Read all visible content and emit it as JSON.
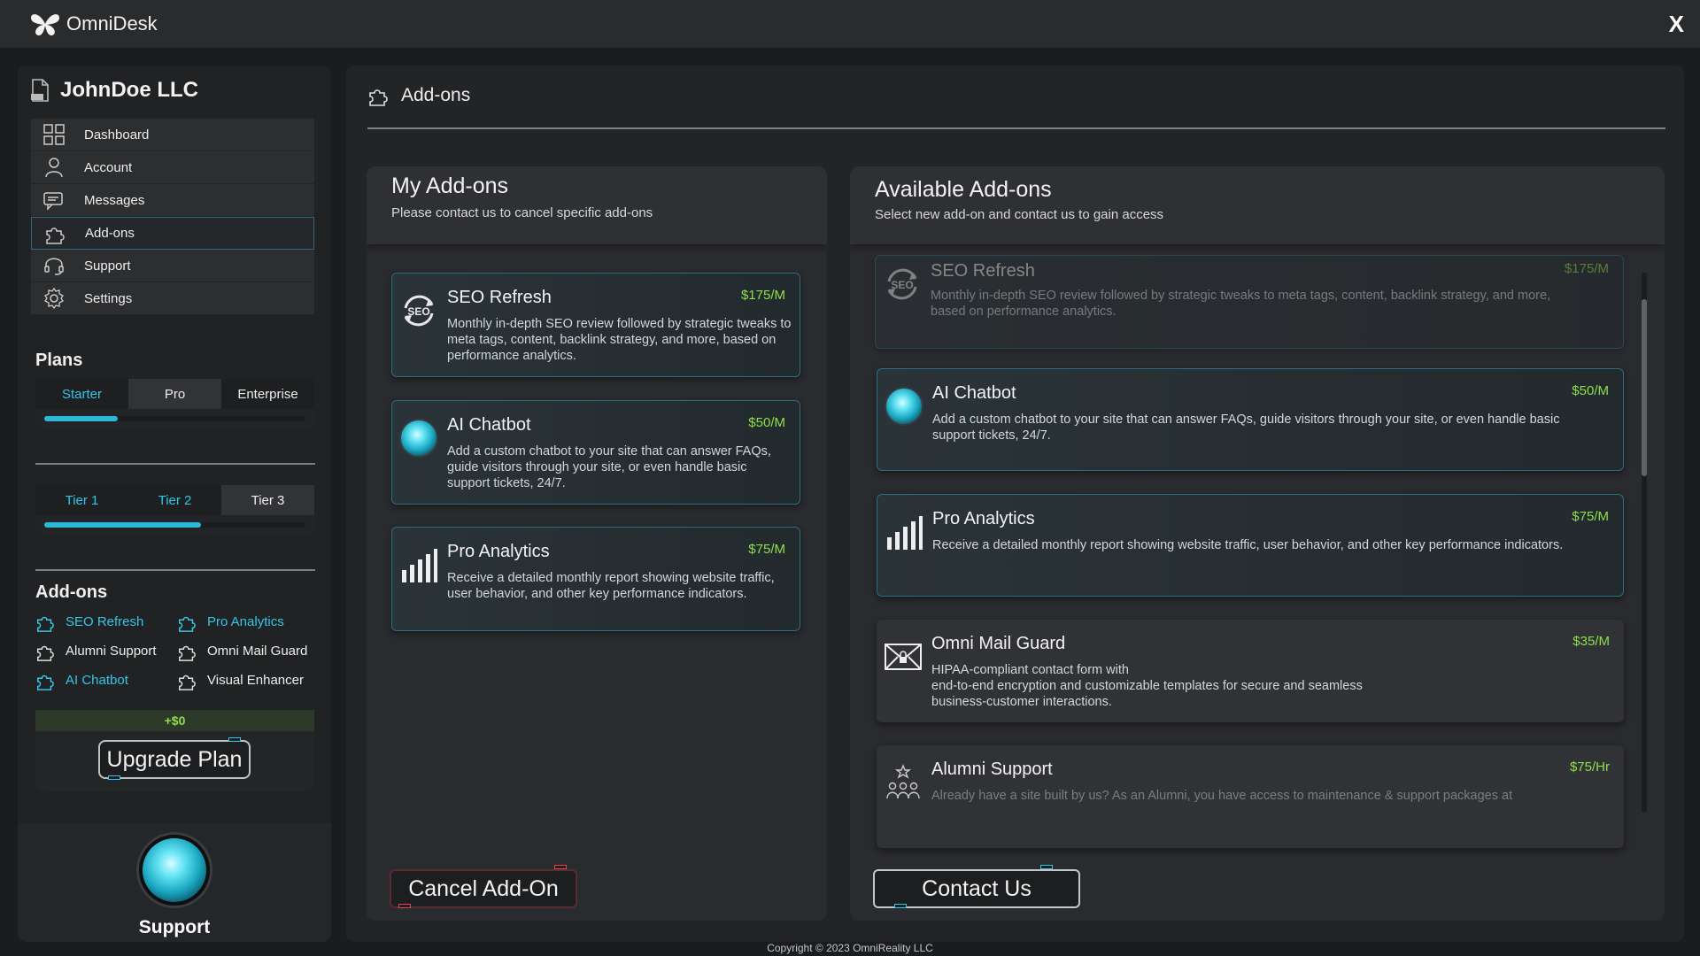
{
  "app": {
    "name": "OmniDesk",
    "close_label": "X"
  },
  "sidebar": {
    "company": "JohnDoe LLC",
    "nav": [
      {
        "label": "Dashboard",
        "icon": "grid-icon"
      },
      {
        "label": "Account",
        "icon": "user-icon"
      },
      {
        "label": "Messages",
        "icon": "chat-icon"
      },
      {
        "label": "Add-ons",
        "icon": "puzzle-icon"
      },
      {
        "label": "Support",
        "icon": "headset-icon"
      },
      {
        "label": "Settings",
        "icon": "gear-icon"
      }
    ],
    "plans_title": "Plans",
    "plan_tabs": [
      "Starter",
      "Pro",
      "Enterprise"
    ],
    "plan_progress": 0.28,
    "tier_tabs": [
      "Tier 1",
      "Tier 2",
      "Tier 3"
    ],
    "tier_progress": 0.6,
    "addons_title": "Add-ons",
    "addons": [
      {
        "label": "SEO Refresh",
        "active": true
      },
      {
        "label": "Pro Analytics",
        "active": true
      },
      {
        "label": "Alumni Support",
        "active": false
      },
      {
        "label": "Omni Mail Guard",
        "active": false
      },
      {
        "label": "AI Chatbot",
        "active": true
      },
      {
        "label": "Visual Enhancer",
        "active": false
      }
    ],
    "price_delta": "+$0",
    "upgrade_label": "Upgrade Plan",
    "support_label": "Support"
  },
  "main": {
    "header": "Add-ons",
    "my_addons": {
      "title": "My Add-ons",
      "subtitle": "Please contact us to cancel specific add-ons",
      "cards": [
        {
          "title": "SEO Refresh",
          "price": "$175/M",
          "desc": "Monthly in-depth SEO review followed by strategic tweaks to meta tags, content, backlink strategy, and more, based on performance analytics."
        },
        {
          "title": "AI Chatbot",
          "price": "$50/M",
          "desc": "Add a custom chatbot to your site that can answer FAQs, guide visitors through your site, or even handle basic support tickets, 24/7."
        },
        {
          "title": "Pro Analytics",
          "price": "$75/M",
          "desc": "Receive a detailed monthly report showing website traffic, user behavior, and other key performance indicators."
        }
      ],
      "cancel_label": "Cancel Add-On"
    },
    "available_addons": {
      "title": "Available Add-ons",
      "subtitle": "Select new add-on and contact us to gain access",
      "cards": [
        {
          "title": "SEO Refresh",
          "price": "$175/M",
          "desc": "Monthly in-depth SEO review followed by strategic tweaks to meta tags, content, backlink strategy, and more, based on performance analytics."
        },
        {
          "title": "AI Chatbot",
          "price": "$50/M",
          "desc": "Add a custom chatbot to your site that can answer FAQs, guide visitors through your site, or even handle basic support tickets, 24/7."
        },
        {
          "title": "Pro Analytics",
          "price": "$75/M",
          "desc": "Receive a detailed monthly report showing website traffic, user behavior, and other key performance indicators."
        },
        {
          "title": "Omni Mail Guard",
          "price": "$35/M",
          "desc_lines": [
            "HIPAA-compliant contact form with",
            "end-to-end encryption and customizable templates for secure and seamless",
            "business-customer interactions."
          ]
        },
        {
          "title": "Alumni Support",
          "price": "$75/Hr",
          "desc": "Already have a site built by us? As an Alumni, you have access to maintenance & support packages at"
        }
      ],
      "contact_label": "Contact Us"
    }
  },
  "footer": {
    "copyright": "Copyright © 2023 OmniReality LLC"
  },
  "colors": {
    "accent": "#33c6e6",
    "price": "#8ce04a",
    "danger": "#e2454e"
  }
}
